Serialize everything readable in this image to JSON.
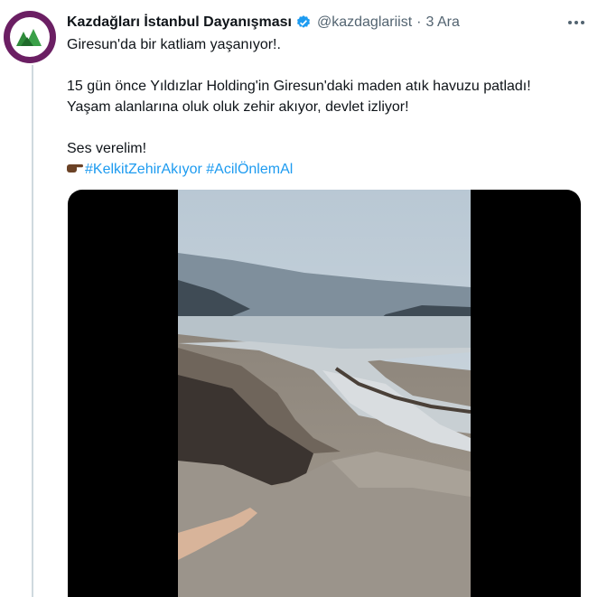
{
  "tweet": {
    "author_name": "Kazdağları İstanbul Dayanışması",
    "author_handle": "@kazdaglariist",
    "separator": "·",
    "timestamp": "3 Ara",
    "lines": [
      "Giresun'da bir katliam yaşanıyor!.",
      "15 gün önce Yıldızlar Holding'in Giresun'daki maden atık havuzu patladı!",
      "Yaşam alanlarına oluk oluk zehir akıyor, devlet izliyor!",
      "Ses verelim!"
    ],
    "hashtags": [
      "#KelkitZehirAkıyor",
      "#AcilÖnlemAl"
    ]
  },
  "icons": {
    "verified": "verified-badge-icon",
    "more": "more-options-icon",
    "pointing": "pointing-finger-emoji"
  },
  "colors": {
    "text": "#0f1419",
    "muted": "#536471",
    "link": "#1d9bf0",
    "avatar_bg": "#6b1f63",
    "thread_line": "#cfd9de"
  }
}
